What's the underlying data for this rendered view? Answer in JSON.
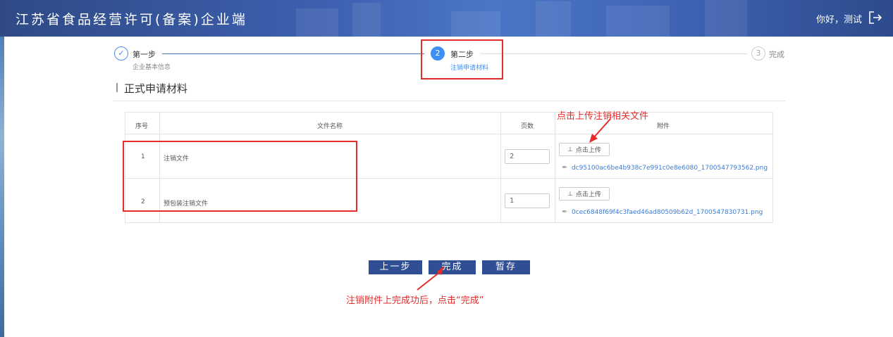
{
  "header": {
    "title": "江苏省食品经营许可(备案)企业端",
    "user_greeting": "你好，测试",
    "logout_icon": "logout-icon"
  },
  "steps": [
    {
      "number": "✓",
      "label": "第一步",
      "sub": "企业基本信息",
      "state": "done"
    },
    {
      "number": "2",
      "label": "第二步",
      "sub": "注销申请材料",
      "state": "active"
    },
    {
      "number": "3",
      "label": "完成",
      "sub": "",
      "state": "pending"
    }
  ],
  "section": {
    "title": "正式申请材料"
  },
  "table": {
    "headers": [
      "序号",
      "文件名称",
      "页数",
      "附件"
    ],
    "rows": [
      {
        "index": "1",
        "name": "注销文件",
        "pages": "2",
        "upload_label": "点击上传",
        "file": "dc95100ac6be4b938c7e991c0e8e6080_1700547793562.png"
      },
      {
        "index": "2",
        "name": "预包装注销文件",
        "pages": "1",
        "upload_label": "点击上传",
        "file": "0cec6848f69f4c3faed46ad80509b62d_1700547830731.png"
      }
    ]
  },
  "buttons": {
    "prev": "上一步",
    "finish": "完成",
    "save": "暂存"
  },
  "annotations": {
    "upload_hint": "点击上传注销相关文件",
    "finish_hint": "注销附件上完成功后，点击“完成”"
  },
  "colors": {
    "header_bg": "#3c5fae",
    "button_bg": "#2f4e93",
    "link": "#3a7bd5",
    "annotation_red": "#e62b2b",
    "active_step": "#3e8ef7"
  }
}
